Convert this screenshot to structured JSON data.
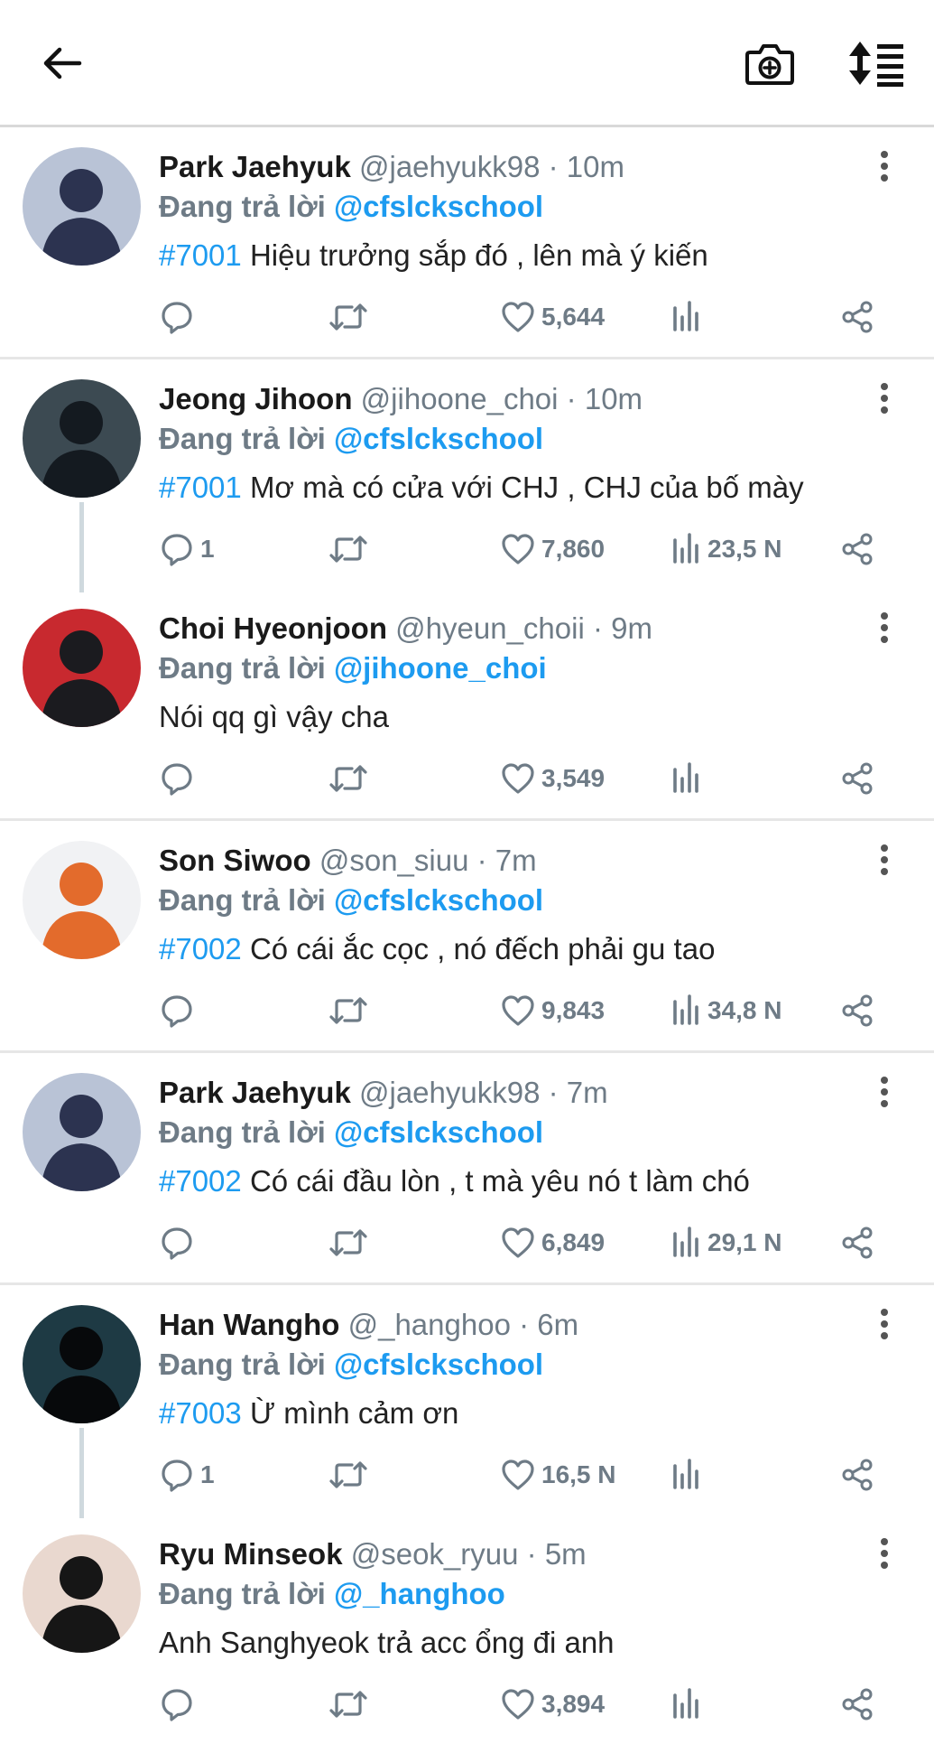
{
  "header": {
    "back_icon": "arrow-left-icon",
    "camera_icon": "camera-plus-icon",
    "sort_icon": "sort-list-icon"
  },
  "labels": {
    "replying_to": "Đang trả lời"
  },
  "colors": {
    "accent": "#1d9bf0",
    "muted": "#6e7b86",
    "divider": "#e6e6e6"
  },
  "tweets": [
    {
      "name": "Park Jaehyuk",
      "handle": "@jaehyukk98",
      "time": "10m",
      "reply_to": "@cfslckschool",
      "hashtag": "#7001",
      "text": "Hiệu trưởng sắp đó , lên mà ý kiến",
      "replies": "",
      "retweets": "",
      "likes": "5,644",
      "views": "",
      "avatar_colors": [
        "#b9c3d6",
        "#2c3350"
      ],
      "thread_line": false,
      "separator": true
    },
    {
      "name": "Jeong Jihoon",
      "handle": "@jihoone_choi",
      "time": "10m",
      "reply_to": "@cfslckschool",
      "hashtag": "#7001",
      "text": "Mơ mà có cửa với CHJ , CHJ của bố mày",
      "replies": "1",
      "retweets": "",
      "likes": "7,860",
      "views": "23,5 N",
      "avatar_colors": [
        "#3c4a52",
        "#141a20"
      ],
      "thread_line": true,
      "separator": false
    },
    {
      "name": "Choi Hyeonjoon",
      "handle": "@hyeun_choii",
      "time": "9m",
      "reply_to": "@jihoone_choi",
      "hashtag": "",
      "text": "Nói qq gì vậy cha",
      "replies": "",
      "retweets": "",
      "likes": "3,549",
      "views": "",
      "avatar_colors": [
        "#c8292f",
        "#1b1b1f"
      ],
      "thread_line": false,
      "separator": true
    },
    {
      "name": "Son Siwoo",
      "handle": "@son_siuu",
      "time": "7m",
      "reply_to": "@cfslckschool",
      "hashtag": "#7002",
      "text": "Có cái ắc cọc , nó đếch phải gu tao",
      "replies": "",
      "retweets": "",
      "likes": "9,843",
      "views": "34,8 N",
      "avatar_colors": [
        "#f1f2f4",
        "#e36b2c"
      ],
      "thread_line": false,
      "separator": true
    },
    {
      "name": "Park Jaehyuk",
      "handle": "@jaehyukk98",
      "time": "7m",
      "reply_to": "@cfslckschool",
      "hashtag": "#7002",
      "text": "Có cái đầu lòn , t mà yêu nó t làm chó",
      "replies": "",
      "retweets": "",
      "likes": "6,849",
      "views": "29,1 N",
      "avatar_colors": [
        "#b9c3d6",
        "#2c3350"
      ],
      "thread_line": false,
      "separator": true
    },
    {
      "name": "Han Wangho",
      "handle": "@_hanghoo",
      "time": "6m",
      "reply_to": "@cfslckschool",
      "hashtag": "#7003",
      "text": "Ừ mình cảm ơn",
      "replies": "1",
      "retweets": "",
      "likes": "16,5 N",
      "views": "",
      "avatar_colors": [
        "#1e3a44",
        "#07090b"
      ],
      "thread_line": true,
      "separator": false
    },
    {
      "name": "Ryu Minseok",
      "handle": "@seok_ryuu",
      "time": "5m",
      "reply_to": "@_hanghoo",
      "hashtag": "",
      "text": "Anh Sanghyeok trả acc ổng đi anh",
      "replies": "",
      "retweets": "",
      "likes": "3,894",
      "views": "",
      "avatar_colors": [
        "#e9d8cf",
        "#161616"
      ],
      "thread_line": false,
      "separator": false
    }
  ]
}
